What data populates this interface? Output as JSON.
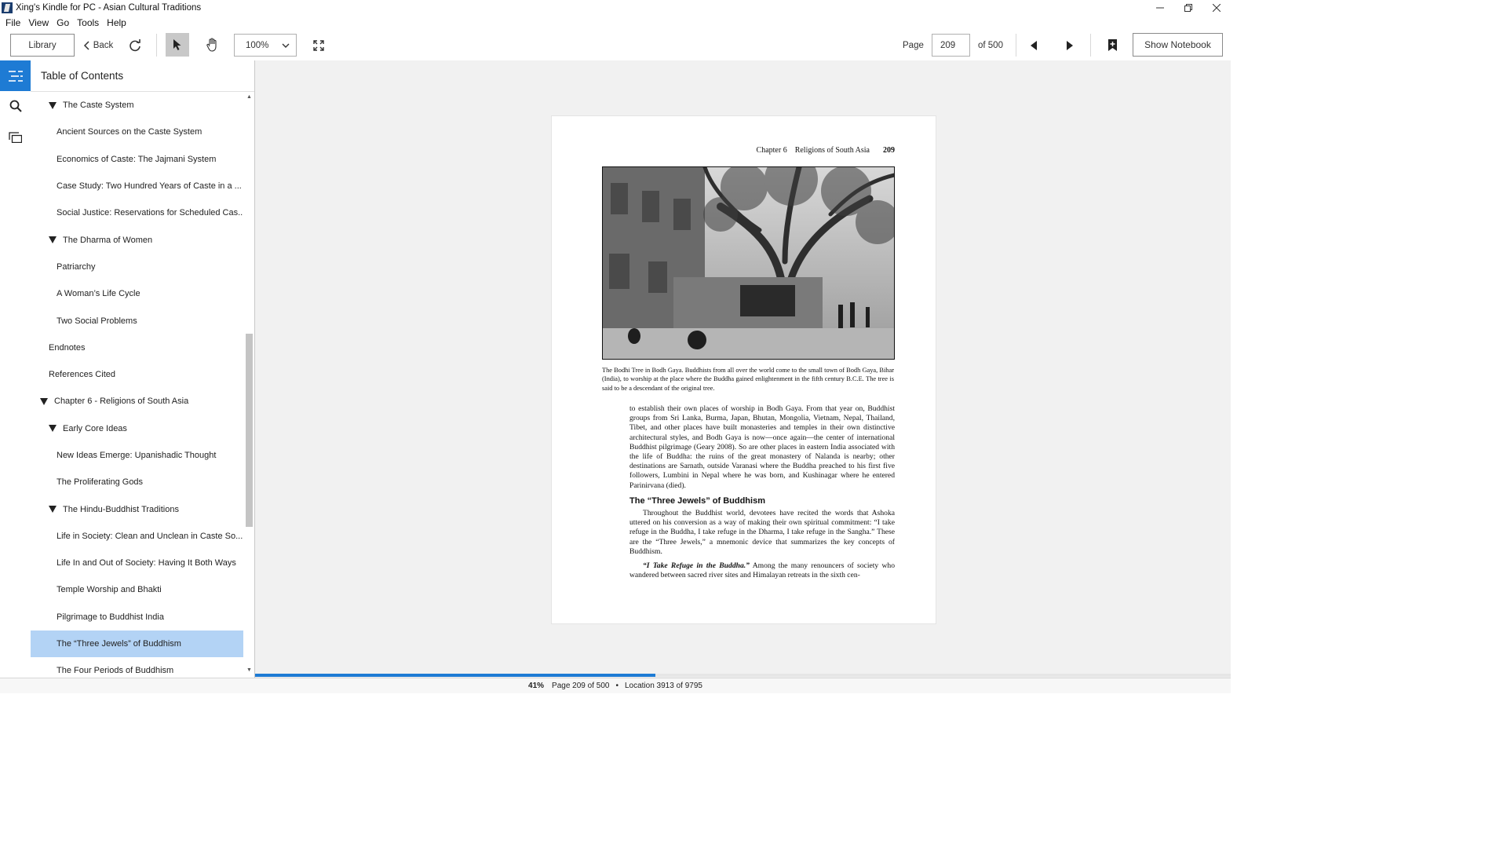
{
  "window": {
    "title": "Xing's Kindle for PC - Asian Cultural Traditions"
  },
  "menu": [
    "File",
    "View",
    "Go",
    "Tools",
    "Help"
  ],
  "toolbar": {
    "library": "Library",
    "back": "Back",
    "zoom": "100%",
    "page_label": "Page",
    "page_value": "209",
    "of_label": "of 500",
    "show_notebook": "Show Notebook"
  },
  "toc": {
    "heading": "Table of Contents",
    "items": [
      {
        "label": "The Caste System",
        "level": 2,
        "expanded": true
      },
      {
        "label": "Ancient Sources on the Caste System",
        "level": 3
      },
      {
        "label": "Economics of Caste: The Jajmani System",
        "level": 3
      },
      {
        "label": "Case Study: Two Hundred Years of Caste in a ...",
        "level": 3
      },
      {
        "label": "Social Justice: Reservations for Scheduled Cas...",
        "level": 3
      },
      {
        "label": "The Dharma of Women",
        "level": 2,
        "expanded": true
      },
      {
        "label": "Patriarchy",
        "level": 3
      },
      {
        "label": "A Woman’s Life Cycle",
        "level": 3
      },
      {
        "label": "Two Social Problems",
        "level": 3
      },
      {
        "label": "Endnotes",
        "level": 1
      },
      {
        "label": "References Cited",
        "level": 1
      },
      {
        "label": "Chapter 6 - Religions of South Asia",
        "level": 0,
        "expanded": true
      },
      {
        "label": "Early Core Ideas",
        "level": 2,
        "expanded": true
      },
      {
        "label": "New Ideas Emerge: Upanishadic Thought",
        "level": 3
      },
      {
        "label": "The Proliferating Gods",
        "level": 3
      },
      {
        "label": "The Hindu-Buddhist Traditions",
        "level": 2,
        "expanded": true
      },
      {
        "label": "Life in Society: Clean and Unclean in Caste So...",
        "level": 3
      },
      {
        "label": "Life In and Out of Society: Having It Both Ways",
        "level": 3
      },
      {
        "label": "Temple Worship and Bhakti",
        "level": 3
      },
      {
        "label": "Pilgrimage to Buddhist India",
        "level": 3
      },
      {
        "label": "The “Three Jewels” of Buddhism",
        "level": 3,
        "selected": true
      },
      {
        "label": "The Four Periods of Buddhism",
        "level": 3
      }
    ]
  },
  "page": {
    "running_head": "Chapter 6    Religions of South Asia",
    "page_number": "209",
    "caption": "The Bodhi Tree in Bodh Gaya. Buddhists from all over the world come to the small town of Bodh Gaya, Bihar (India), to worship at the place where the Buddha gained enlightenment in the fifth century B.C.E. The tree is said to be a descendant of the original tree.",
    "para1": "to establish their own places of worship in Bodh Gaya. From that year on, Buddhist groups from Sri Lanka, Burma, Japan, Bhutan, Mongolia, Vietnam, Nepal, Thailand, Tibet, and other places have built monasteries and temples in their own distinctive architectural styles, and Bodh Gaya is now—once again—the center of international Buddhist pilgrimage (Geary 2008). So are other places in eastern India associated with the life of Buddha: the ruins of the great monastery of Nalanda is nearby; other destinations are Sarnath, outside Varanasi where the Buddha preached to his first five followers, Lumbini in Nepal where he was born, and Kushinagar where he entered Parinirvana (died).",
    "heading": "The “Three Jewels” of Buddhism",
    "para2": "Throughout the Buddhist world, devotees have recited the words that Ashoka uttered on his conversion as a way of making their own spiritual commitment: “I take refuge in the Buddha, I take refuge in the Dharma, I take refuge in the Sangha.” These are the “Three Jewels,” a mnemonic device that summarizes the key concepts of Buddhism.",
    "para3_lead": "“I Take Refuge in the Buddha.”",
    "para3": "Among the many renouncers of society who wandered between sacred river sites and Himalayan retreats in the sixth cen-"
  },
  "progress_fraction": 0.41,
  "status": {
    "percent": "41%",
    "page": "Page 209 of 500",
    "separator": "•",
    "location": "Location 3913 of 9795"
  },
  "colors": {
    "accent": "#1e7bd4",
    "selected": "#b3d3f5"
  }
}
